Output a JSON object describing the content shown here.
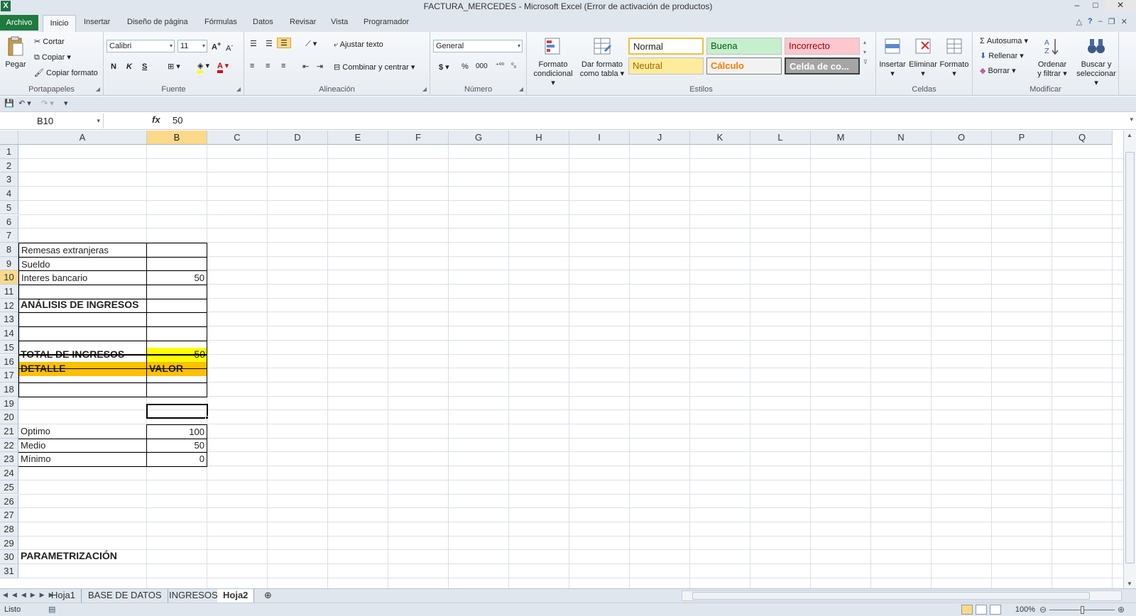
{
  "window": {
    "title": "FACTURA_MERCEDES - Microsoft Excel (Error de activación de productos)"
  },
  "tabs": [
    "Archivo",
    "Inicio",
    "Insertar",
    "Diseño de página",
    "Fórmulas",
    "Datos",
    "Revisar",
    "Vista",
    "Programador"
  ],
  "ribbon": {
    "portapapeles": {
      "paste": "Pegar",
      "cut": "Cortar",
      "copy": "Copiar",
      "format_painter": "Copiar formato",
      "label": "Portapapeles"
    },
    "fuente": {
      "font": "Calibri",
      "size": "11",
      "bold": "N",
      "italic": "K",
      "underline": "S",
      "label": "Fuente"
    },
    "alineacion": {
      "wrap": "Ajustar texto",
      "merge": "Combinar y centrar",
      "label": "Alineación"
    },
    "numero": {
      "format": "General",
      "currency": "$",
      "percent": "%",
      "thousands": "000",
      "label": "Número"
    },
    "estilos": {
      "cond_format_1": "Formato",
      "cond_format_2": "condicional",
      "table_format_1": "Dar formato",
      "table_format_2": "como tabla",
      "normal": "Normal",
      "buena": "Buena",
      "incorrecto": "Incorrecto",
      "neutral": "Neutral",
      "calculo": "Cálculo",
      "celda": "Celda de co...",
      "label": "Estilos"
    },
    "celdas": {
      "insert": "Insertar",
      "delete": "Eliminar",
      "format": "Formato",
      "label": "Celdas"
    },
    "modificar": {
      "autosum": "Autosuma",
      "fill": "Rellenar",
      "clear": "Borrar",
      "sort_1": "Ordenar",
      "sort_2": "y filtrar",
      "find_1": "Buscar y",
      "find_2": "seleccionar",
      "label": "Modificar"
    }
  },
  "formula_bar": {
    "name_box": "B10",
    "fx": "fx",
    "value": "50"
  },
  "columns": [
    "A",
    "B",
    "C",
    "D",
    "E",
    "F",
    "G",
    "H",
    "I",
    "J",
    "K",
    "L",
    "M",
    "N",
    "O",
    "P",
    "Q"
  ],
  "rows": [
    "1",
    "2",
    "3",
    "4",
    "5",
    "6",
    "7",
    "8",
    "9",
    "10",
    "11",
    "12",
    "13",
    "14",
    "15",
    "16",
    "17",
    "18",
    "19",
    "20",
    "21",
    "22",
    "23",
    "24",
    "25",
    "26",
    "27",
    "28",
    "29",
    "30",
    "31"
  ],
  "sheet": {
    "title": "ANÁLISIS DE INGRESOS",
    "total_label": "TOTAL DE INGRESOS",
    "total_value": "50",
    "detail_header": "DETALLE",
    "value_header": "VALOR",
    "items": [
      {
        "label": "Remesas extranjeras",
        "value": ""
      },
      {
        "label": "Sueldo",
        "value": ""
      },
      {
        "label": "Interes bancario",
        "value": "50"
      }
    ],
    "param_title": "PARAMETRIZACIÓN",
    "params": [
      {
        "label": "Optimo",
        "value": "100"
      },
      {
        "label": "Medio",
        "value": "50"
      },
      {
        "label": "Mínimo",
        "value": "0"
      }
    ]
  },
  "sheet_tabs": [
    "Hoja1",
    "BASE DE DATOS",
    "INGRESOS",
    "Hoja2"
  ],
  "status": {
    "ready": "Listo",
    "zoom": "100%"
  },
  "colors": {
    "total_fill": "#ffff00",
    "header_fill": "#ffc000",
    "excel_green": "#1f7a3f"
  }
}
